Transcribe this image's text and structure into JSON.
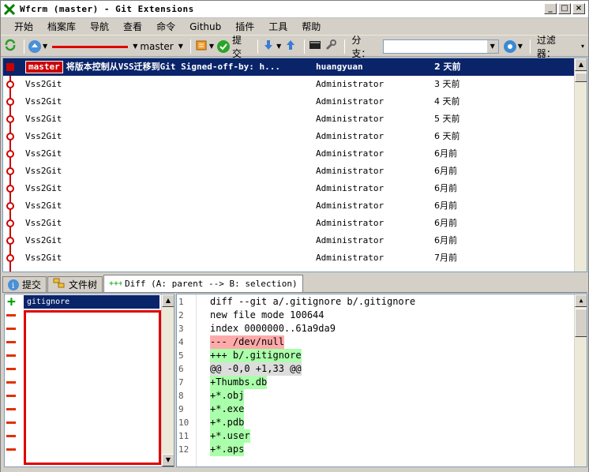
{
  "window": {
    "title": "Wfcrm (master) - Git Extensions",
    "buttons": [
      "_",
      "□",
      "×"
    ]
  },
  "menu": [
    "开始",
    "档案库",
    "导航",
    "查看",
    "命令",
    "Github",
    "插件",
    "工具",
    "帮助"
  ],
  "toolbar": {
    "branch": "master",
    "commit_label": "提交",
    "branch_filter_label": "分支：",
    "filter_label": "过滤器："
  },
  "commits": [
    {
      "ref": "master",
      "message": "将版本控制从VSS迁移到Git Signed-off-by: h...",
      "author": "huangyuan",
      "date": "2 天前",
      "selected": true
    },
    {
      "message": "Vss2Git",
      "author": "Administrator",
      "date": "3 天前"
    },
    {
      "message": "Vss2Git",
      "author": "Administrator",
      "date": "4 天前"
    },
    {
      "message": "Vss2Git",
      "author": "Administrator",
      "date": "5 天前"
    },
    {
      "message": "Vss2Git",
      "author": "Administrator",
      "date": "6 天前"
    },
    {
      "message": "Vss2Git",
      "author": "Administrator",
      "date": "6月前"
    },
    {
      "message": "Vss2Git",
      "author": "Administrator",
      "date": "6月前"
    },
    {
      "message": "Vss2Git",
      "author": "Administrator",
      "date": "6月前"
    },
    {
      "message": "Vss2Git",
      "author": "Administrator",
      "date": "6月前"
    },
    {
      "message": "Vss2Git",
      "author": "Administrator",
      "date": "6月前"
    },
    {
      "message": "Vss2Git",
      "author": "Administrator",
      "date": "6月前"
    },
    {
      "message": "Vss2Git",
      "author": "Administrator",
      "date": "7月前"
    }
  ],
  "tabs": [
    {
      "label": "提交"
    },
    {
      "label": "文件树"
    },
    {
      "label": "Diff (A: parent --> B: selection)"
    }
  ],
  "files": [
    {
      "name": "gitignore",
      "status": "added"
    }
  ],
  "diff_lines": [
    {
      "n": "1",
      "text": "diff --git a/.gitignore b/.gitignore",
      "hl": ""
    },
    {
      "n": "2",
      "text": "new file mode 100644",
      "hl": ""
    },
    {
      "n": "3",
      "text": "index 0000000..61a9da9",
      "hl": ""
    },
    {
      "n": "4",
      "text": "--- /dev/null",
      "hl": "red"
    },
    {
      "n": "5",
      "text": "+++ b/.gitignore",
      "hl": "green"
    },
    {
      "n": "6",
      "text": "@@ -0,0 +1,33 @@",
      "hl": "gray"
    },
    {
      "n": "7",
      "text": "+Thumbs.db",
      "hl": "green"
    },
    {
      "n": "8",
      "text": "+*.obj",
      "hl": "green"
    },
    {
      "n": "9",
      "text": "+*.exe",
      "hl": "green"
    },
    {
      "n": "10",
      "text": "+*.pdb",
      "hl": "green"
    },
    {
      "n": "11",
      "text": "+*.user",
      "hl": "green"
    },
    {
      "n": "12",
      "text": "+*.aps",
      "hl": "green"
    }
  ],
  "colors": {
    "selection": "#0a246a",
    "graph": "#cc0000",
    "added": "#aaffaa",
    "removed": "#ffaaaa"
  }
}
